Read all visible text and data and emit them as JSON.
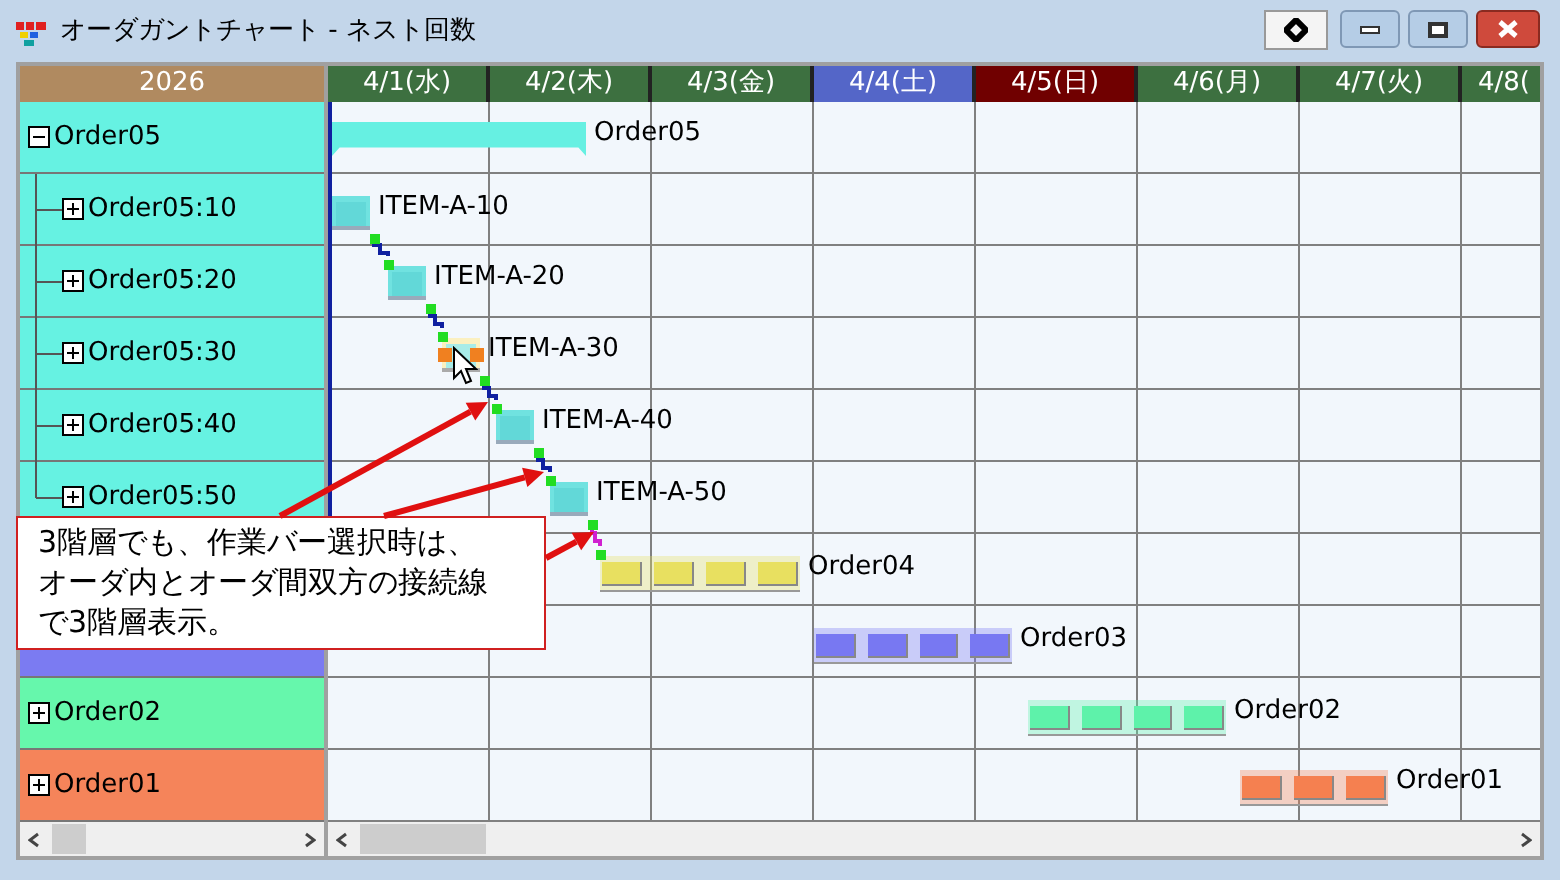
{
  "window": {
    "title": "オーダガントチャート - ネスト回数"
  },
  "tree": {
    "header": "2026",
    "items": [
      {
        "label": "Order05",
        "expanded": true,
        "color": "#66f2e2",
        "children": [
          {
            "label": "Order05:10",
            "expanded": false
          },
          {
            "label": "Order05:20",
            "expanded": false
          },
          {
            "label": "Order05:30",
            "expanded": false
          },
          {
            "label": "Order05:40",
            "expanded": false
          },
          {
            "label": "Order05:50",
            "expanded": false
          }
        ]
      },
      {
        "color": "#7b7bf2"
      },
      {
        "label": "Order02",
        "expanded": false,
        "color": "#66f7ac"
      },
      {
        "label": "Order01",
        "expanded": false,
        "color": "#f5845a"
      }
    ]
  },
  "days": [
    {
      "label": "4/1(水)",
      "color": "#3d7040"
    },
    {
      "label": "4/2(木)",
      "color": "#3d7040"
    },
    {
      "label": "4/3(金)",
      "color": "#3d7040"
    },
    {
      "label": "4/4(土)",
      "color": "#5466c8"
    },
    {
      "label": "4/5(日)",
      "color": "#700000"
    },
    {
      "label": "4/6(月)",
      "color": "#3d7040"
    },
    {
      "label": "4/7(火)",
      "color": "#3d7040"
    },
    {
      "label": "4/8(",
      "color": "#3d7040"
    }
  ],
  "bars": [
    {
      "label": "Order05",
      "kind": "summary",
      "color": "#66f0e2"
    },
    {
      "label": "ITEM-A-10",
      "kind": "task",
      "selected": false
    },
    {
      "label": "ITEM-A-20",
      "kind": "task",
      "selected": false
    },
    {
      "label": "ITEM-A-30",
      "kind": "task",
      "selected": true
    },
    {
      "label": "ITEM-A-40",
      "kind": "task",
      "selected": false
    },
    {
      "label": "ITEM-A-50",
      "kind": "task",
      "selected": false
    },
    {
      "label": "Order04",
      "kind": "order",
      "color": "#e8e060"
    },
    {
      "label": "Order03",
      "kind": "order",
      "color": "#7878f2"
    },
    {
      "label": "Order02",
      "kind": "order",
      "color": "#5ef2aa"
    },
    {
      "label": "Order01",
      "kind": "order",
      "color": "#f58050"
    }
  ],
  "callout": {
    "text": "3階層でも、作業バー選択時は、オーダ内とオーダ間双方の接続線で3階層表示。"
  }
}
